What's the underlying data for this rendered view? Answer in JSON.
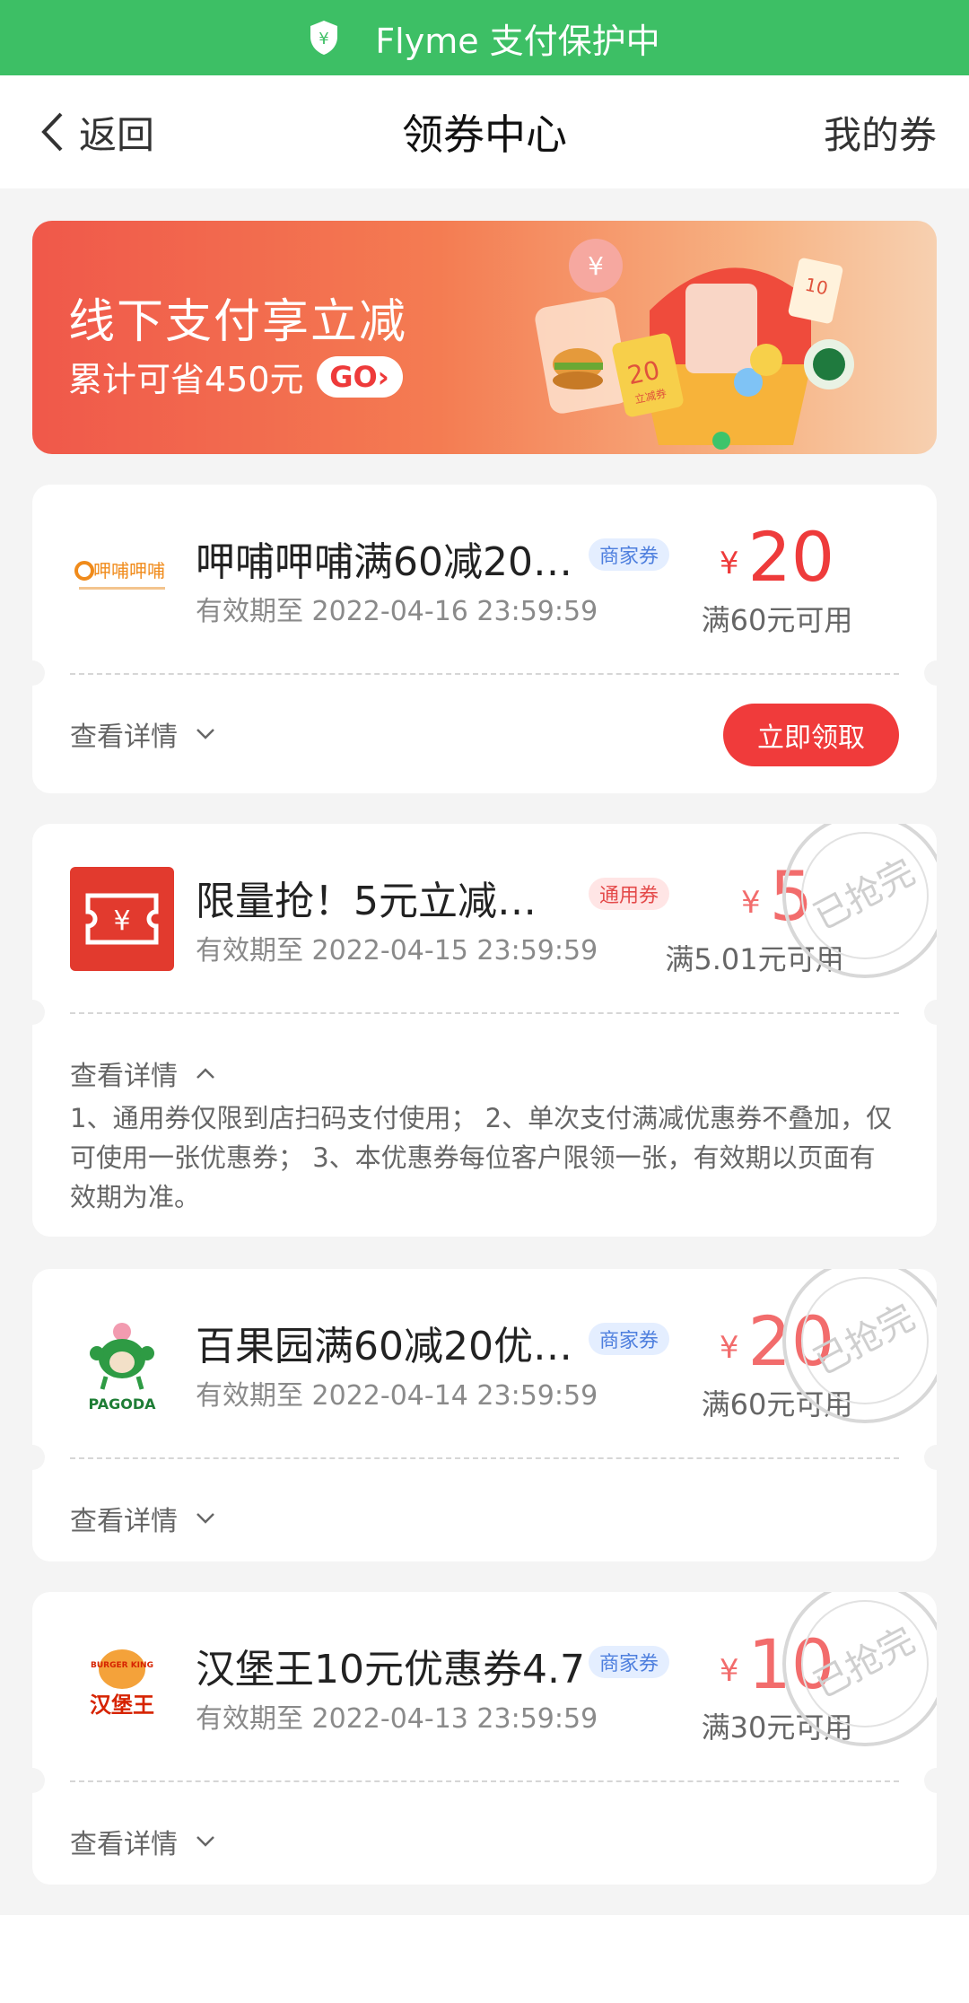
{
  "status_bar": {
    "text": "Flyme 支付保护中"
  },
  "nav": {
    "back_label": "返回",
    "title": "领券中心",
    "right_label": "我的券"
  },
  "banner": {
    "title": "线下支付享立减",
    "subtitle": "累计可省450元",
    "go_label": "GO",
    "ticket_amount": "20",
    "ticket_label": "立减券",
    "card_amount": "10"
  },
  "coupons": [
    {
      "merchant_logo_text": "呷哺呷哺",
      "title": "呷哺呷哺满60减20…",
      "tag": "商家券",
      "expire": "有效期至 2022-04-16 23:59:59",
      "currency": "¥",
      "amount": "20",
      "min_use": "满60元可用",
      "detail_label": "查看详情",
      "button_label": "立即领取"
    },
    {
      "title": "限量抢！5元立减…",
      "tag": "通用券",
      "expire": "有效期至 2022-04-15 23:59:59",
      "currency": "¥",
      "amount": "5",
      "min_use": "满5.01元可用",
      "detail_label": "查看详情",
      "stamp_text": "已抢完",
      "rules": "1、通用券仅限到店扫码支付使用； 2、单次支付满减优惠券不叠加，仅可使用一张优惠券； 3、本优惠券每位客户限领一张，有效期以页面有效期为准。"
    },
    {
      "merchant_logo_text": "PAGODA",
      "title": "百果园满60减20优…",
      "tag": "商家券",
      "expire": "有效期至 2022-04-14 23:59:59",
      "currency": "¥",
      "amount": "20",
      "min_use": "满60元可用",
      "detail_label": "查看详情",
      "stamp_text": "已抢完"
    },
    {
      "merchant_logo_text_top": "BURGER KING",
      "merchant_logo_text": "汉堡王",
      "title": "汉堡王10元优惠券4.7",
      "tag": "商家券",
      "expire": "有效期至 2022-04-13 23:59:59",
      "currency": "¥",
      "amount": "10",
      "min_use": "满30元可用",
      "detail_label": "查看详情",
      "stamp_text": "已抢完"
    }
  ]
}
